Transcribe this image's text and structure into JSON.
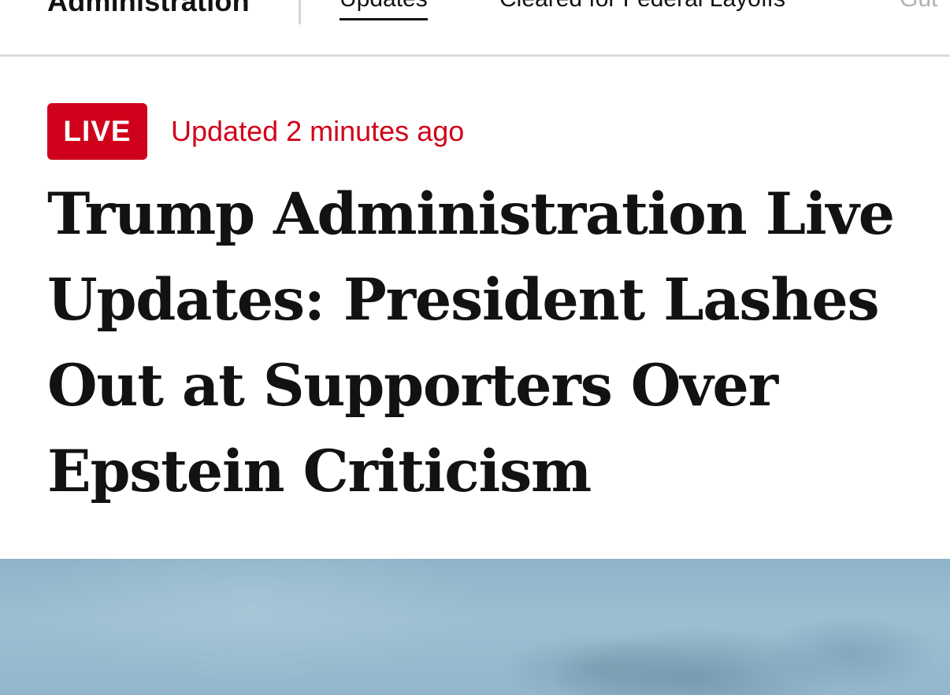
{
  "topnav": {
    "section_title": "Administration",
    "tabs": [
      {
        "label": "Updates",
        "active": true
      },
      {
        "label": "Cleared for Federal Layoffs",
        "active": false
      },
      {
        "label": "Gut",
        "active": false
      }
    ]
  },
  "live": {
    "badge_label": "LIVE",
    "updated_text": "Updated 2 minutes ago",
    "accent_color": "#d0021b"
  },
  "article": {
    "headline": "Trump Administration Live Updates: President Lashes Out at Supporters Over Epstein Criticism"
  },
  "colors": {
    "text": "#121212",
    "accent": "#d0021b",
    "divider": "#dcdcdc"
  }
}
